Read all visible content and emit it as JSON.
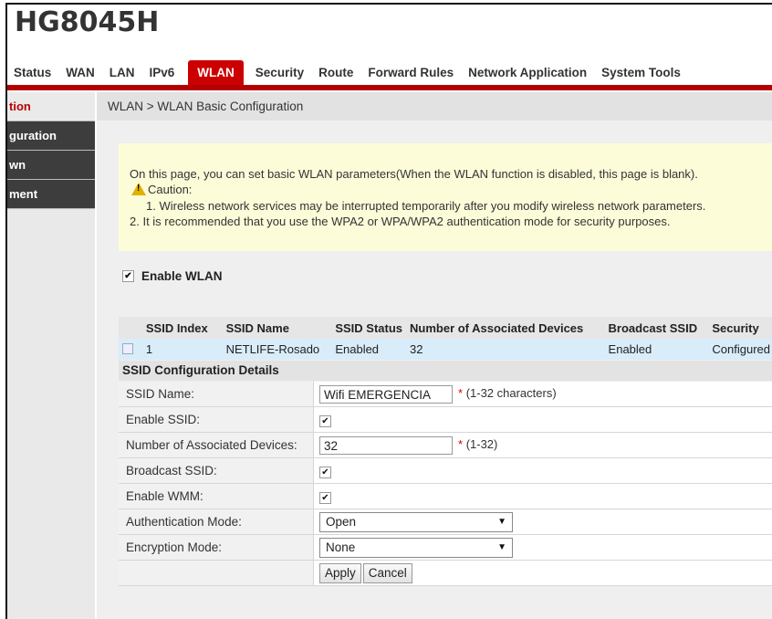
{
  "header": {
    "brand": "HG8045H",
    "nav": [
      "Status",
      "WAN",
      "LAN",
      "IPv6",
      "WLAN",
      "Security",
      "Route",
      "Forward Rules",
      "Network Application",
      "System Tools"
    ],
    "active_nav": "WLAN"
  },
  "sidebar": {
    "items": [
      "tion",
      "guration",
      "wn",
      "ment"
    ]
  },
  "breadcrumb": "WLAN > WLAN Basic Configuration",
  "notice": {
    "line1": "On this page, you can set basic WLAN parameters(When the WLAN function is disabled, this page is blank).",
    "caution": "Caution:",
    "line2": "1. Wireless network services may be interrupted temporarily after you modify wireless network parameters.",
    "line3": "2. It is recommended that you use the WPA2 or WPA/WPA2 authentication mode for security purposes."
  },
  "enable_wlan": {
    "label": "Enable WLAN",
    "checked": true
  },
  "ssid_table": {
    "headers": [
      "SSID Index",
      "SSID Name",
      "SSID Status",
      "Number of Associated Devices",
      "Broadcast SSID",
      "Security"
    ],
    "rows": [
      {
        "index": "1",
        "name": "NETLIFE-Rosado",
        "status": "Enabled",
        "devices": "32",
        "broadcast": "Enabled",
        "security": "Configured"
      }
    ]
  },
  "details": {
    "title": "SSID Configuration Details",
    "ssid_name_label": "SSID Name:",
    "ssid_name_value": "Wifi EMERGENCIA",
    "ssid_name_hint": "(1-32 characters)",
    "enable_ssid_label": "Enable SSID:",
    "devices_label": "Number of Associated Devices:",
    "devices_value": "32",
    "devices_hint": "(1-32)",
    "broadcast_label": "Broadcast SSID:",
    "wmm_label": "Enable WMM:",
    "auth_label": "Authentication Mode:",
    "auth_value": "Open",
    "enc_label": "Encryption Mode:",
    "enc_value": "None",
    "apply": "Apply",
    "cancel": "Cancel"
  }
}
